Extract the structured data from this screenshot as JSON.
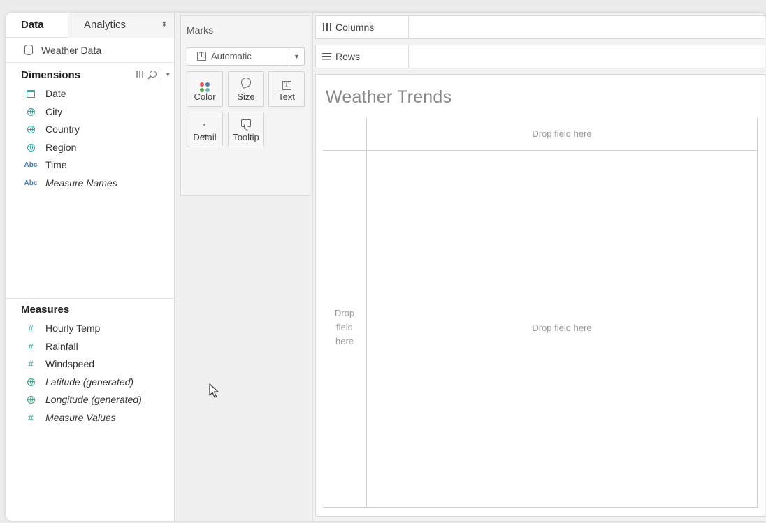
{
  "data_pane": {
    "tabs": [
      {
        "label": "Data"
      },
      {
        "label": "Analytics"
      }
    ],
    "datasource": "Weather Data",
    "dimensions_title": "Dimensions",
    "dimensions": [
      {
        "label": "Date",
        "icon": "calendar-icon"
      },
      {
        "label": "City",
        "icon": "globe-icon"
      },
      {
        "label": "Country",
        "icon": "globe-icon"
      },
      {
        "label": "Region",
        "icon": "globe-icon"
      },
      {
        "label": "Time",
        "icon": "abc-icon"
      },
      {
        "label": "Measure Names",
        "icon": "abc-icon",
        "italic": true
      }
    ],
    "measures_title": "Measures",
    "measures": [
      {
        "label": "Hourly Temp",
        "icon": "hash-icon"
      },
      {
        "label": "Rainfall",
        "icon": "hash-icon"
      },
      {
        "label": "Windspeed",
        "icon": "hash-icon"
      },
      {
        "label": "Latitude (generated)",
        "icon": "globe-icon",
        "italic": true
      },
      {
        "label": "Longitude (generated)",
        "icon": "globe-icon",
        "italic": true
      },
      {
        "label": "Measure Values",
        "icon": "hash-icon",
        "italic": true
      }
    ],
    "abc_glyph": "Abc",
    "hash_glyph": "#"
  },
  "marks": {
    "title": "Marks",
    "mark_type": "Automatic",
    "buttons": {
      "color": "Color",
      "size": "Size",
      "text": "Text",
      "detail": "Detail",
      "tooltip": "Tooltip"
    },
    "text_glyph": "T"
  },
  "shelves": {
    "columns": "Columns",
    "rows": "Rows"
  },
  "view": {
    "title": "Weather Trends",
    "drop_columns": "Drop field here",
    "drop_rows": "Drop\nfield\nhere",
    "drop_body": "Drop field here"
  },
  "colors": {
    "geo_icon": "#2aa7a0",
    "abc_icon": "#4c78a8",
    "color_dots": [
      "#e15759",
      "#4e79a7",
      "#59a14f",
      "#76b7b2"
    ]
  }
}
